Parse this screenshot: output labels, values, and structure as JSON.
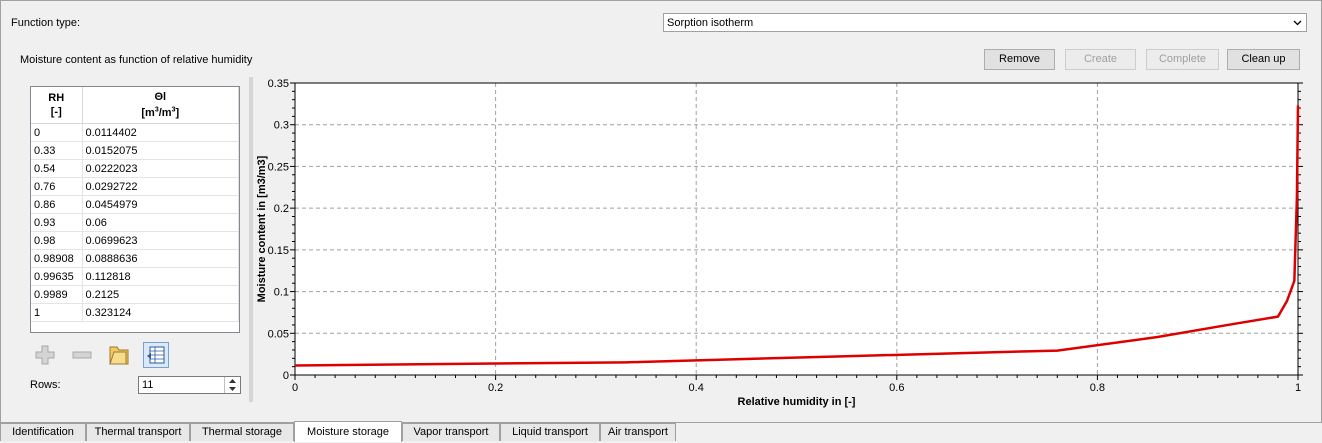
{
  "function_type_label": "Function type:",
  "function_type_value": "Sorption isotherm",
  "subtitle": "Moisture content as function of relative humidity",
  "buttons": {
    "remove": "Remove",
    "create": "Create",
    "complete": "Complete",
    "clean_up": "Clean up"
  },
  "table": {
    "col1_header_line1": "RH",
    "col1_header_line2": "[-]",
    "col2_header_line1": "Θl",
    "col2_header_m": "[m",
    "col2_header_mid": "/m",
    "col2_header_sup": "3",
    "col2_header_end": "]",
    "rows": [
      [
        "0",
        "0.0114402"
      ],
      [
        "0.33",
        "0.0152075"
      ],
      [
        "0.54",
        "0.0222023"
      ],
      [
        "0.76",
        "0.0292722"
      ],
      [
        "0.86",
        "0.0454979"
      ],
      [
        "0.93",
        "0.06"
      ],
      [
        "0.98",
        "0.0699623"
      ],
      [
        "0.98908",
        "0.0888636"
      ],
      [
        "0.99635",
        "0.112818"
      ],
      [
        "0.9989",
        "0.2125"
      ],
      [
        "1",
        "0.323124"
      ]
    ]
  },
  "icons": [
    "add-icon",
    "remove-row-icon",
    "open-file-icon",
    "import-table-icon"
  ],
  "rows_label": "Rows:",
  "rows_value": "11",
  "chart_data": {
    "type": "line",
    "xlabel": "Relative humidity in [-]",
    "ylabel": "Moisture content in [m3/m3]",
    "xlim": [
      0,
      1
    ],
    "ylim": [
      0,
      0.35
    ],
    "xticks": [
      "0",
      "0.2",
      "0.4",
      "0.6",
      "0.8",
      "1"
    ],
    "yticks": [
      "0",
      "0.05",
      "0.1",
      "0.15",
      "0.2",
      "0.25",
      "0.3",
      "0.35"
    ],
    "grid": true,
    "series": [
      {
        "color": "#dd0000",
        "x": [
          0,
          0.33,
          0.54,
          0.76,
          0.86,
          0.93,
          0.98,
          0.98908,
          0.99635,
          0.9989,
          1
        ],
        "y": [
          0.0114402,
          0.0152075,
          0.0222023,
          0.0292722,
          0.0454979,
          0.06,
          0.0699623,
          0.0888636,
          0.112818,
          0.2125,
          0.323124
        ]
      }
    ]
  },
  "tabs": [
    "Identification",
    "Thermal transport",
    "Thermal storage",
    "Moisture storage",
    "Vapor transport",
    "Liquid transport",
    "Air transport"
  ],
  "active_tab": "Moisture storage"
}
